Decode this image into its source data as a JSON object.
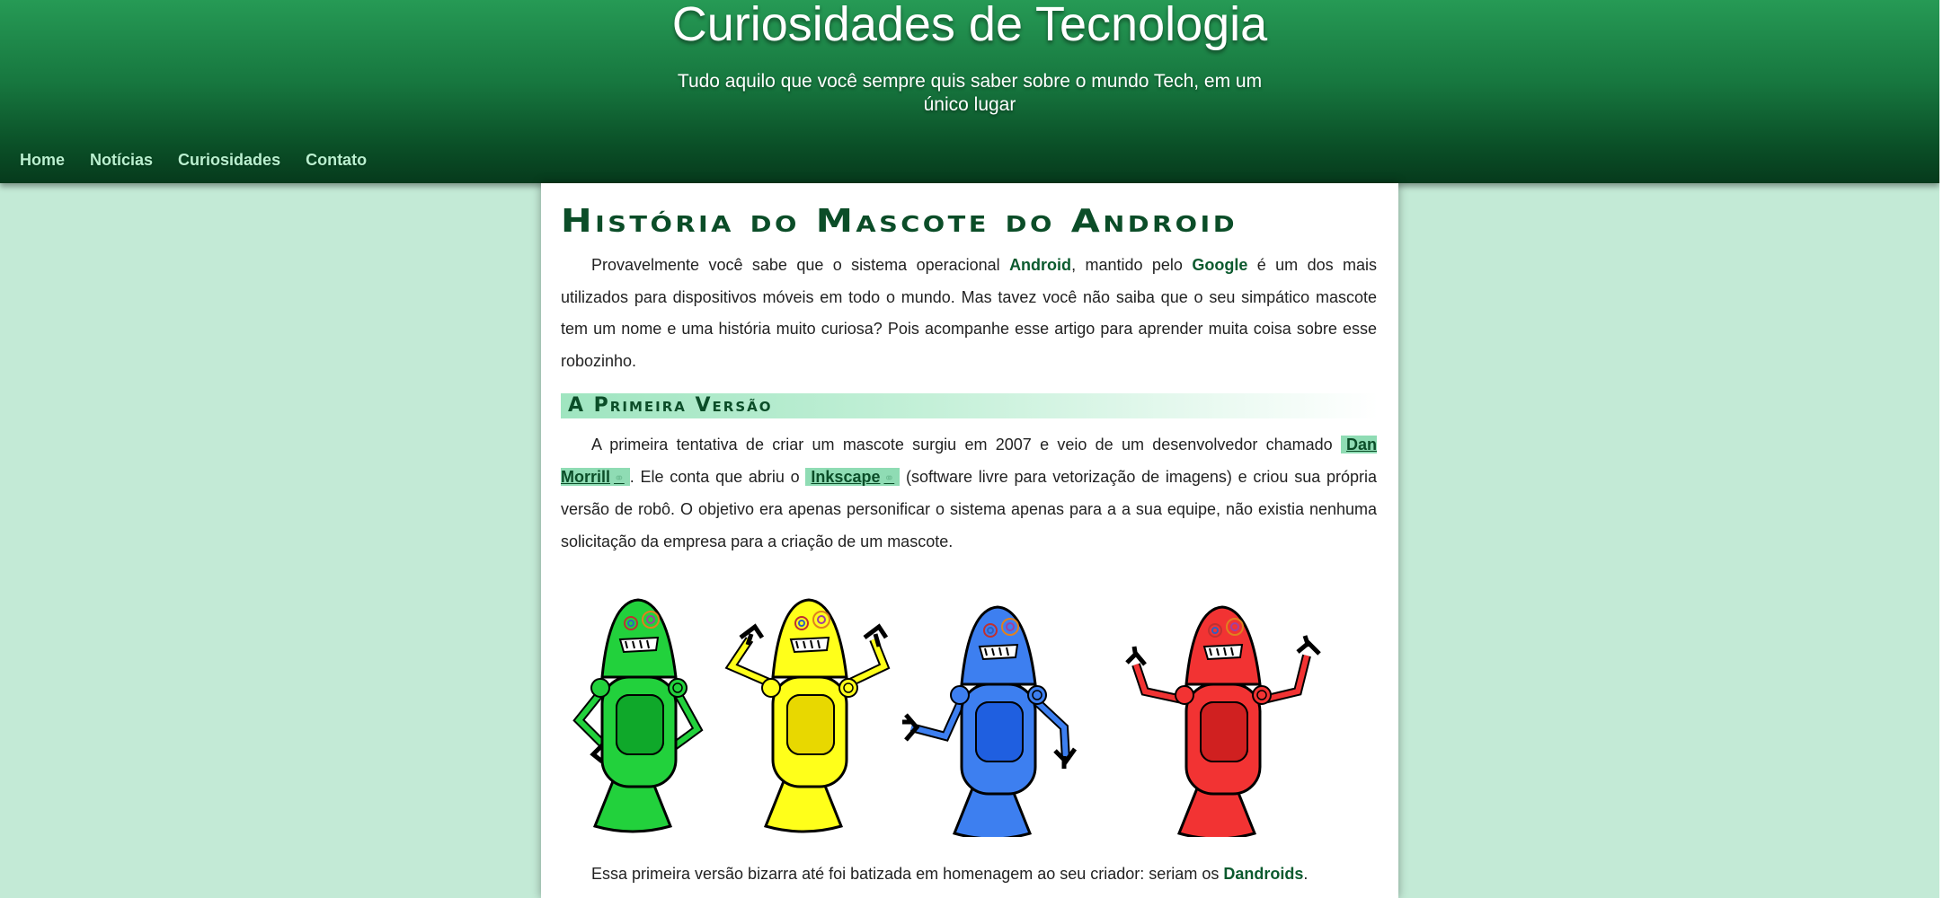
{
  "header": {
    "title": "Curiosidades de Tecnologia",
    "subtitle": "Tudo aquilo que você sempre quis saber sobre o mundo Tech, em um único lugar"
  },
  "nav": {
    "items": [
      {
        "label": "Home"
      },
      {
        "label": "Notícias"
      },
      {
        "label": "Curiosidades"
      },
      {
        "label": "Contato"
      }
    ]
  },
  "article": {
    "title": "História do Mascote do Android",
    "intro": {
      "t1": "Provavelmente você sabe que o sistema operacional ",
      "b1": "Android",
      "t2": ", mantido pelo ",
      "b2": "Google",
      "t3": " é um dos mais utilizados para dispositivos móveis em todo o mundo. Mas tavez você não saiba que o seu simpático mascote tem um nome e uma história muito curiosa? Pois acompanhe esse artigo para aprender muita coisa sobre esse robozinho."
    },
    "section1": {
      "heading": "A Primeira Versão",
      "p": {
        "t1": "A primeira tentativa de criar um mascote surgiu em 2007 e veio de um desenvolvedor chamado ",
        "link1": "Dan Morrill",
        "t2": ". Ele conta que abriu o ",
        "link2": "Inkscape",
        "t3": " (software livre para vetorização de imagens) e criou sua própria versão de robô. O objetivo era apenas personificar o sistema apenas para a a sua equipe, não existia nenhuma solicitação da empresa para a criação de um mascote."
      },
      "p2": {
        "t1": "Essa primeira versão bizarra até foi batizada em homenagem ao seu criador: seriam os ",
        "b1": "Dandroids",
        "t2": "."
      }
    },
    "robots": [
      {
        "color": "#22d13c",
        "dark": "#0fa82a"
      },
      {
        "color": "#ffff1a",
        "dark": "#e8d800"
      },
      {
        "color": "#3d7ff0",
        "dark": "#1f5fe0"
      },
      {
        "color": "#f23333",
        "dark": "#d02020"
      }
    ]
  }
}
